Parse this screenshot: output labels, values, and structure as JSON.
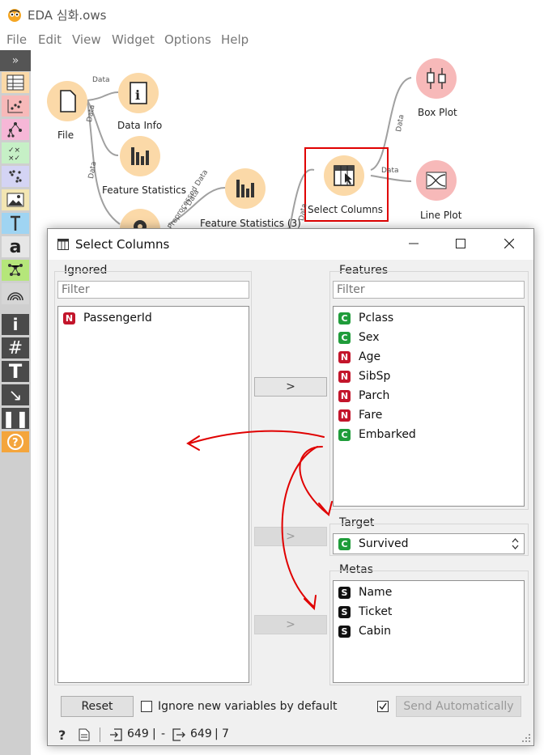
{
  "app": {
    "title": "EDA 심화.ows",
    "menu": [
      "File",
      "Edit",
      "View",
      "Widget",
      "Options",
      "Help"
    ]
  },
  "toolbox": {
    "collapse_label": "»",
    "categories": [
      "data",
      "visualize",
      "model",
      "evaluate",
      "unsupervised",
      "image-analytics",
      "text-mining",
      "text-a",
      "network",
      "spectroscopy"
    ],
    "tools": [
      "info-icon",
      "grid-icon",
      "text-icon",
      "arrow-icon",
      "pause-icon",
      "help-icon"
    ]
  },
  "canvas": {
    "nodes": [
      {
        "label": "File"
      },
      {
        "label": "Data Info"
      },
      {
        "label": "Feature Statistics"
      },
      {
        "label": "Feature Statistics (3)"
      },
      {
        "label": "Select Columns"
      },
      {
        "label": "Box Plot"
      },
      {
        "label": "Line Plot"
      }
    ],
    "links": [
      "Data",
      "Data",
      "Data",
      "Preprocessed Data",
      "→ Data",
      "Data",
      "Data",
      "Data"
    ]
  },
  "dialog": {
    "title": "Select Columns",
    "ignored": {
      "title": "Ignored",
      "filter_placeholder": "Filter",
      "items": [
        {
          "type": "N",
          "name": "PassengerId"
        }
      ]
    },
    "features": {
      "title": "Features",
      "filter_placeholder": "Filter",
      "items": [
        {
          "type": "C",
          "name": "Pclass"
        },
        {
          "type": "C",
          "name": "Sex"
        },
        {
          "type": "N",
          "name": "Age"
        },
        {
          "type": "N",
          "name": "SibSp"
        },
        {
          "type": "N",
          "name": "Parch"
        },
        {
          "type": "N",
          "name": "Fare"
        },
        {
          "type": "C",
          "name": "Embarked"
        }
      ]
    },
    "target": {
      "title": "Target",
      "selected": {
        "type": "C",
        "name": "Survived"
      }
    },
    "metas": {
      "title": "Metas",
      "items": [
        {
          "type": "S",
          "name": "Name"
        },
        {
          "type": "S",
          "name": "Ticket"
        },
        {
          "type": "S",
          "name": "Cabin"
        }
      ]
    },
    "move_label": ">",
    "reset_label": "Reset",
    "ignore_new_label": "Ignore new variables by default",
    "send_auto_label": "Send Automatically",
    "status": {
      "input_rows": "649",
      "separator1": "|",
      "dash": "-",
      "output_rows": "649",
      "separator2": "|",
      "output_cols": "7"
    }
  },
  "colors": {
    "categorical": "#1f9c3a",
    "numeric": "#c3152b",
    "string": "#111111",
    "node_orange": "#fbd9a8",
    "node_pink": "#f7b9b9",
    "annotation_red": "#e00000"
  }
}
